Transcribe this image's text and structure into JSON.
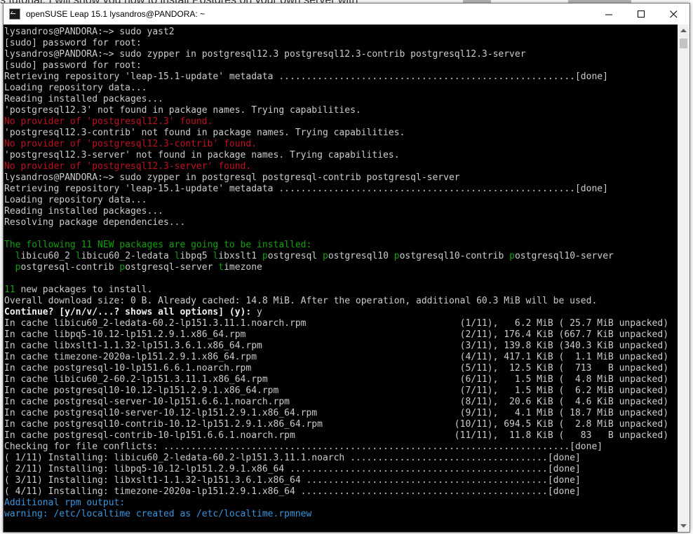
{
  "background": {
    "text_above": "s tutorial, I will show you how to install Postgres on your own server with",
    "text_left": "b",
    "left_marks": [
      "g",
      "9",
      "1"
    ]
  },
  "window": {
    "title": "openSUSE Leap 15.1  lysandros@PANDORA: ~",
    "controls": {
      "minimize": "minimize",
      "maximize": "maximize",
      "close": "close"
    }
  },
  "terminal": {
    "lines": [
      [
        {
          "t": "lysandros@PANDORA:~> sudo yast2"
        }
      ],
      [
        {
          "t": "[sudo] password for root:"
        }
      ],
      [
        {
          "t": "lysandros@PANDORA:~> sudo zypper in postgresql12.3 postgresql12.3-contrib postgresql12.3-server"
        }
      ],
      [
        {
          "t": "[sudo] password for root:"
        }
      ],
      [
        {
          "t": "Retrieving repository 'leap-15.1-update' metadata ......................................................[done]"
        }
      ],
      [
        {
          "t": "Loading repository data..."
        }
      ],
      [
        {
          "t": "Reading installed packages..."
        }
      ],
      [
        {
          "t": "'postgresql12.3' not found in package names. Trying capabilities."
        }
      ],
      [
        {
          "t": "No provider of 'postgresql12.3' found.",
          "c": "red"
        }
      ],
      [
        {
          "t": "'postgresql12.3-contrib' not found in package names. Trying capabilities."
        }
      ],
      [
        {
          "t": "No provider of 'postgresql12.3-contrib' found.",
          "c": "red"
        }
      ],
      [
        {
          "t": "'postgresql12.3-server' not found in package names. Trying capabilities."
        }
      ],
      [
        {
          "t": "No provider of 'postgresql12.3-server' found.",
          "c": "red"
        }
      ],
      [
        {
          "t": "lysandros@PANDORA:~> sudo zypper in postgresql postgresql-contrib postgresql-server"
        }
      ],
      [
        {
          "t": "Retrieving repository 'leap-15.1-update' metadata ......................................................[done]"
        }
      ],
      [
        {
          "t": "Loading repository data..."
        }
      ],
      [
        {
          "t": "Reading installed packages..."
        }
      ],
      [
        {
          "t": "Resolving package dependencies..."
        }
      ],
      [
        {
          "t": ""
        }
      ],
      [
        {
          "t": "The following 11 NEW packages are going to be installed:",
          "c": "green"
        }
      ],
      [
        {
          "t": "  "
        },
        {
          "t": "l",
          "c": "green"
        },
        {
          "t": "ibicu60_2 "
        },
        {
          "t": "l",
          "c": "green"
        },
        {
          "t": "ibicu60_2-ledata "
        },
        {
          "t": "l",
          "c": "green"
        },
        {
          "t": "ibpq5 "
        },
        {
          "t": "l",
          "c": "green"
        },
        {
          "t": "ibxslt1 "
        },
        {
          "t": "p",
          "c": "green"
        },
        {
          "t": "ostgresql "
        },
        {
          "t": "p",
          "c": "green"
        },
        {
          "t": "ostgresql10 "
        },
        {
          "t": "p",
          "c": "green"
        },
        {
          "t": "ostgresql10-contrib "
        },
        {
          "t": "p",
          "c": "green"
        },
        {
          "t": "ostgresql10-server"
        }
      ],
      [
        {
          "t": "  "
        },
        {
          "t": "p",
          "c": "green"
        },
        {
          "t": "ostgresql-contrib "
        },
        {
          "t": "p",
          "c": "green"
        },
        {
          "t": "ostgresql-server "
        },
        {
          "t": "t",
          "c": "green"
        },
        {
          "t": "imezone"
        }
      ],
      [
        {
          "t": ""
        }
      ],
      [
        {
          "t": "11",
          "c": "green"
        },
        {
          "t": " new packages to install."
        }
      ],
      [
        {
          "t": "Overall download size: 0 B. Already cached: 14.8 MiB. After the operation, additional 60.3 MiB will be used."
        }
      ],
      [
        {
          "t": "Continue? [y/n/v/...? shows all options] (y): ",
          "c": "bold"
        },
        {
          "t": "y"
        }
      ],
      [
        {
          "t": "In cache libicu60_2-ledata-60.2-lp151.3.11.1.noarch.rpm                            (1/11),   6.2 MiB ( 25.7 MiB unpacked)"
        }
      ],
      [
        {
          "t": "In cache libpq5-10.12-lp151.2.9.1.x86_64.rpm                                       (2/11), 176.4 KiB (667.7 KiB unpacked)"
        }
      ],
      [
        {
          "t": "In cache libxslt1-1.1.32-lp151.3.6.1.x86_64.rpm                                    (3/11), 139.8 KiB (340.3 KiB unpacked)"
        }
      ],
      [
        {
          "t": "In cache timezone-2020a-lp151.2.9.1.x86_64.rpm                                     (4/11), 417.1 KiB (  1.1 MiB unpacked)"
        }
      ],
      [
        {
          "t": "In cache postgresql-10-lp151.6.6.1.noarch.rpm                                      (5/11),  12.5 KiB (  713   B unpacked)"
        }
      ],
      [
        {
          "t": "In cache libicu60_2-60.2-lp151.3.11.1.x86_64.rpm                                   (6/11),   1.5 MiB (  4.8 MiB unpacked)"
        }
      ],
      [
        {
          "t": "In cache postgresql10-10.12-lp151.2.9.1.x86_64.rpm                                 (7/11),   1.5 MiB (  6.2 MiB unpacked)"
        }
      ],
      [
        {
          "t": "In cache postgresql-server-10-lp151.6.6.1.noarch.rpm                               (8/11),  20.6 KiB (  4.6 KiB unpacked)"
        }
      ],
      [
        {
          "t": "In cache postgresql10-server-10.12-lp151.2.9.1.x86_64.rpm                          (9/11),   4.1 MiB ( 18.7 MiB unpacked)"
        }
      ],
      [
        {
          "t": "In cache postgresql10-contrib-10.12-lp151.2.9.1.x86_64.rpm                        (10/11), 694.5 KiB (  2.8 MiB unpacked)"
        }
      ],
      [
        {
          "t": "In cache postgresql-contrib-10-lp151.6.6.1.noarch.rpm                             (11/11),  11.8 KiB (   83   B unpacked)"
        }
      ],
      [
        {
          "t": "Checking for file conflicts: ..........................................................................[done]"
        }
      ],
      [
        {
          "t": "( 1/11) Installing: libicu60_2-ledata-60.2-lp151.3.11.1.noarch ....................................[done]"
        }
      ],
      [
        {
          "t": "( 2/11) Installing: libpq5-10.12-lp151.2.9.1.x86_64 ...............................................[done]"
        }
      ],
      [
        {
          "t": "( 3/11) Installing: libxslt1-1.1.32-lp151.3.6.1.x86_64 ............................................[done]"
        }
      ],
      [
        {
          "t": "( 4/11) Installing: timezone-2020a-lp151.2.9.1.x86_64 .............................................[done]"
        }
      ],
      [
        {
          "t": "Additional rpm output:",
          "c": "teal"
        }
      ],
      [
        {
          "t": "warning: /etc/localtime created as /etc/localtime.rpmnew",
          "c": "teal"
        }
      ]
    ]
  },
  "colors": {
    "terminal_bg": "#000000",
    "text": "#cccccc",
    "red": "#c50f1f",
    "green": "#13a10e",
    "teal": "#3a96dd"
  },
  "icons": [
    "terminal-app-icon",
    "minimize-icon",
    "maximize-icon",
    "close-icon",
    "scroll-up-icon",
    "scroll-down-icon"
  ]
}
